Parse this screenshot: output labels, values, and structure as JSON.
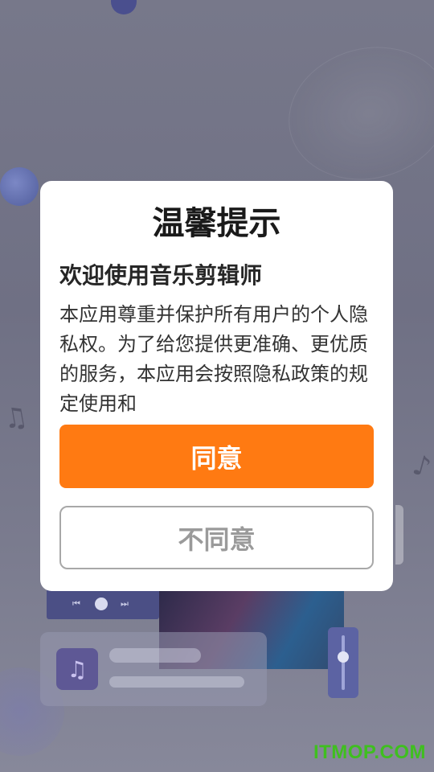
{
  "dialog": {
    "title": "温馨提示",
    "subtitle": "欢迎使用音乐剪辑师",
    "body": "本应用尊重并保护所有用户的个人隐私权。为了给您提供更准确、更优质的服务，本应用会按照隐私政策的规定使用和",
    "agree_label": "同意",
    "disagree_label": "不同意"
  },
  "background": {
    "music_icon": "music-note-icon",
    "player_prev_icon": "prev-icon",
    "player_play_icon": "play-icon",
    "player_next_icon": "next-icon"
  },
  "watermark": "ITMOP.COM",
  "colors": {
    "accent": "#ff7a12",
    "overlay": "#77788a",
    "dialog_bg": "#ffffff",
    "watermark": "#3fbf1f"
  }
}
